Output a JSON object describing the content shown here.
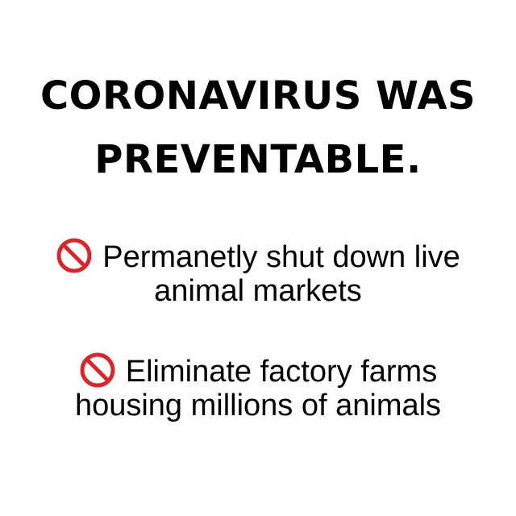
{
  "headline": {
    "line1": "CORONAVIRUS WAS",
    "line2": "PREVENTABLE."
  },
  "points": [
    {
      "icon": "prohibited-icon",
      "line1": "Permanetly shut down live",
      "line2": "animal markets"
    },
    {
      "icon": "prohibited-icon",
      "line1": "Eliminate factory farms",
      "line2": "housing millions of animals"
    }
  ],
  "colors": {
    "background": "#ffffff",
    "text": "#000000",
    "icon": "#d9262c"
  }
}
